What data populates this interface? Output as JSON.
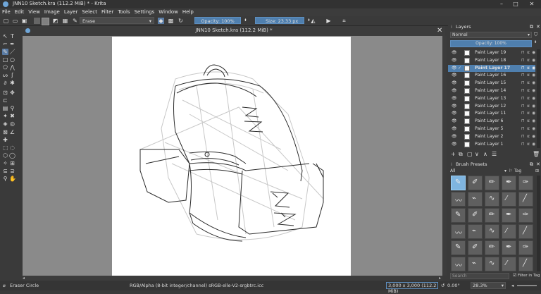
{
  "window": {
    "title": "JNN10 Sketch.kra (112.2 MiB) * - Krita",
    "controls": [
      "–",
      "□",
      "✕"
    ]
  },
  "menu": [
    "File",
    "Edit",
    "View",
    "Image",
    "Layer",
    "Select",
    "Filter",
    "Tools",
    "Settings",
    "Window",
    "Help"
  ],
  "toolbar": {
    "blend_mode": "Erase",
    "opacity": "Opacity: 100%",
    "size": "Size: 23.33 px"
  },
  "document": {
    "tab_title": "JNN10 Sketch.kra (112.2 MiB) *"
  },
  "layers": {
    "title": "Layers",
    "blend": "Normal",
    "opacity": "Opacity:  100%",
    "items": [
      {
        "name": "Paint Layer 19",
        "selected": false
      },
      {
        "name": "Paint Layer 18",
        "selected": false
      },
      {
        "name": "Paint Layer 17",
        "selected": true
      },
      {
        "name": "Paint Layer 16",
        "selected": false
      },
      {
        "name": "Paint Layer 15",
        "selected": false
      },
      {
        "name": "Paint Layer 14",
        "selected": false
      },
      {
        "name": "Paint Layer 13",
        "selected": false
      },
      {
        "name": "Paint Layer 12",
        "selected": false
      },
      {
        "name": "Paint Layer 11",
        "selected": false
      },
      {
        "name": "Paint Layer 6",
        "selected": false
      },
      {
        "name": "Paint Layer 5",
        "selected": false
      },
      {
        "name": "Paint Layer 2",
        "selected": false
      },
      {
        "name": "Paint Layer 1",
        "selected": false
      }
    ]
  },
  "brush_presets": {
    "title": "Brush Presets",
    "filter": "All",
    "tag": "Tag",
    "search_placeholder": "Search",
    "filter_in_tag": "Filter in Tag"
  },
  "status": {
    "tool": "Eraser Circle",
    "color_space": "RGB/Alpha (8-bit integer/channel)  sRGB-elle-V2-srgbtrc.icc",
    "dimensions": "3,000 x 3,000 (112.2 MiB)",
    "rotation": "0.00°",
    "zoom": "28.3%"
  },
  "colors": {
    "accent": "#4f7fae",
    "canvas_bg": "#8a8a8a",
    "ui_bg": "#3a3a3a"
  }
}
